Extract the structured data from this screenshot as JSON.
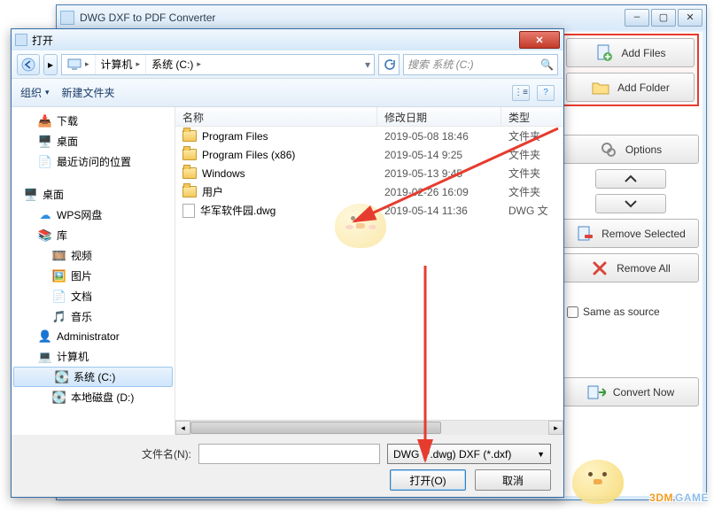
{
  "app": {
    "title": "DWG DXF to PDF Converter",
    "winMin": "—",
    "winMax": "▢",
    "winClose": "✕"
  },
  "side": {
    "addFiles": "Add Files",
    "addFolder": "Add Folder",
    "options": "Options",
    "removeSelected": "Remove Selected",
    "removeAll": "Remove All",
    "sameAsSource": "Same as source",
    "convertNow": "Convert Now"
  },
  "dialog": {
    "title": "打开",
    "closeX": "✕",
    "navBackIcon": "◄",
    "navFwdIcon": "▸",
    "path": {
      "seg1": "计算机",
      "seg2": "系统 (C:)"
    },
    "searchPlaceholder": "搜索 系统 (C:)",
    "toolbar": {
      "organize": "组织",
      "newFolder": "新建文件夹",
      "viewIcon": "⋮≡",
      "helpIcon": "?"
    },
    "columns": {
      "name": "名称",
      "date": "修改日期",
      "type": "类型"
    },
    "tree": {
      "downloads": "下载",
      "desktop1": "桌面",
      "recent": "最近访问的位置",
      "desktop2": "桌面",
      "wps": "WPS网盘",
      "library": "库",
      "video": "视频",
      "pictures": "图片",
      "documents": "文档",
      "music": "音乐",
      "admin": "Administrator",
      "computer": "计算机",
      "sysC": "系统 (C:)",
      "localD": "本地磁盘 (D:)"
    },
    "files": [
      {
        "name": "Program Files",
        "date": "2019-05-08 18:46",
        "type": "文件夹",
        "kind": "folder"
      },
      {
        "name": "Program Files (x86)",
        "date": "2019-05-14 9:25",
        "type": "文件夹",
        "kind": "folder"
      },
      {
        "name": "Windows",
        "date": "2019-05-13 9:45",
        "type": "文件夹",
        "kind": "folder"
      },
      {
        "name": "用户",
        "date": "2019-02-26 16:09",
        "type": "文件夹",
        "kind": "folder"
      },
      {
        "name": "华军软件园.dwg",
        "date": "2019-05-14 11:36",
        "type": "DWG 文",
        "kind": "file"
      }
    ],
    "footer": {
      "filenameLabel": "文件名(N):",
      "filter": "DWG (*.dwg) DXF (*.dxf)",
      "open": "打开(O)",
      "cancel": "取消"
    }
  },
  "watermark": "3DMGAME"
}
